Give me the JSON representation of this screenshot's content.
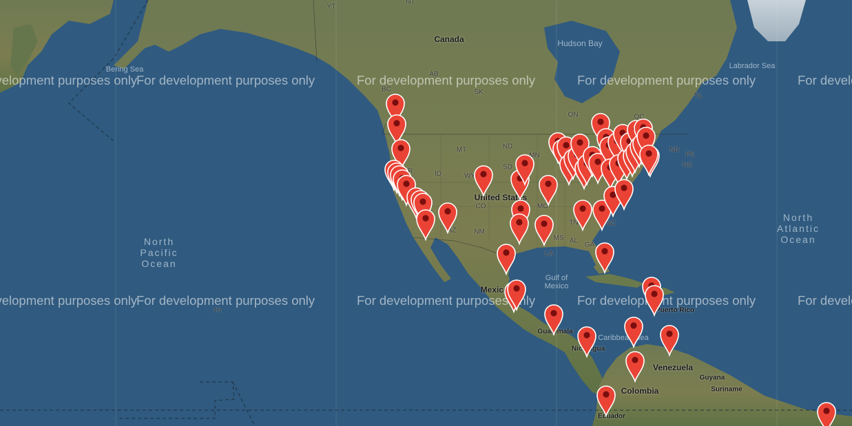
{
  "map": {
    "watermark_text": "For development purposes only",
    "labels": {
      "canada": "Canada",
      "united_states": "United States",
      "mexico": "Mexico",
      "guatemala": "Guatemala",
      "nicaragua": "Nicaragua",
      "colombia": "Colombia",
      "venezuela": "Venezuela",
      "guyana": "Guyana",
      "suriname": "Suriname",
      "ecuador": "Ecuador",
      "puerto_rico": "Puerto Rico",
      "hudson_bay": "Hudson Bay",
      "labrador_sea": "Labrador Sea",
      "bering_sea": "Bering Sea",
      "gulf_of_mexico": "Gulf of Mexico",
      "caribbean_sea": "Caribbean Sea",
      "north_pacific_ocean": "North Pacific Ocean",
      "north_atlantic_ocean": "North Atlantic Ocean",
      "hi": "HI",
      "yt": "YT",
      "nt": "NT",
      "bc": "BC",
      "ab": "AB",
      "sk": "SK",
      "on": "ON",
      "qc": "QC",
      "nl": "NL",
      "nb": "NB",
      "pe": "PE",
      "ns": "NS",
      "mt": "MT",
      "nd": "ND",
      "mn": "MN",
      "sd": "SD",
      "id": "ID",
      "or": "OR",
      "wy": "WY",
      "co": "CO",
      "nm": "NM",
      "az": "AZ",
      "tn": "TN",
      "nc": "NC",
      "ms": "MS",
      "al": "AL",
      "ga": "GA",
      "la": "LA",
      "mo": "MO",
      "ar": "AR"
    },
    "colors": {
      "ocean": "#305a7f",
      "land": "#6e7b4e",
      "marker_fill": "#ea4335",
      "marker_stroke": "#ffffff",
      "marker_dot": "#7a0e0e"
    },
    "marker_icon": "map-pin-icon"
  }
}
